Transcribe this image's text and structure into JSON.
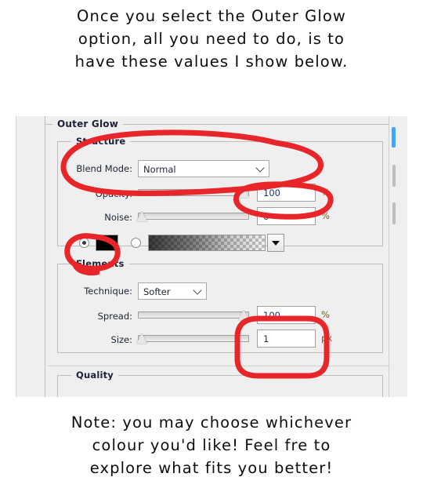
{
  "caption_top": {
    "lines": [
      "Once you select the Outer Glow",
      "option, all you need to do, is to",
      "have these values I show below."
    ]
  },
  "caption_bottom": {
    "lines": [
      "Note: you may choose whichever",
      "colour you'd like! Feel fre to",
      "explore what fits you better!"
    ]
  },
  "dialog": {
    "section_title": "Outer Glow",
    "structure": {
      "title": "Structure",
      "blend_mode": {
        "label": "Blend Mode:",
        "value": "Normal"
      },
      "opacity": {
        "label": "Opacity:",
        "value": "100",
        "unit": "%",
        "slider_percent": 100
      },
      "noise": {
        "label": "Noise:",
        "value": "0",
        "unit": "%",
        "slider_percent": 0
      },
      "fill_type": {
        "color_radio_selected": true,
        "color_swatch": "#000000",
        "gradient_radio_selected": false,
        "gradient_preview_name": "black-to-transparent-gradient"
      }
    },
    "elements": {
      "title": "Elements",
      "technique": {
        "label": "Technique:",
        "value": "Softer"
      },
      "spread": {
        "label": "Spread:",
        "value": "100",
        "unit": "%",
        "slider_percent": 100
      },
      "size": {
        "label": "Size:",
        "value": "1",
        "unit": "px",
        "slider_percent": 0
      }
    },
    "quality": {
      "title": "Quality"
    }
  },
  "annotations": {
    "color": "#e8262a",
    "marks": [
      "circle-blend-mode-row",
      "circle-opacity-value",
      "circle-color-radio-and-swatch",
      "circle-spread-and-size-values"
    ]
  },
  "colors": {
    "panel_background": "#efefef",
    "scroll_marker": "#4aa3ef",
    "group_title_text": "#1b2235",
    "value_text": "#17315e",
    "unit_text": "#7a5a12"
  }
}
